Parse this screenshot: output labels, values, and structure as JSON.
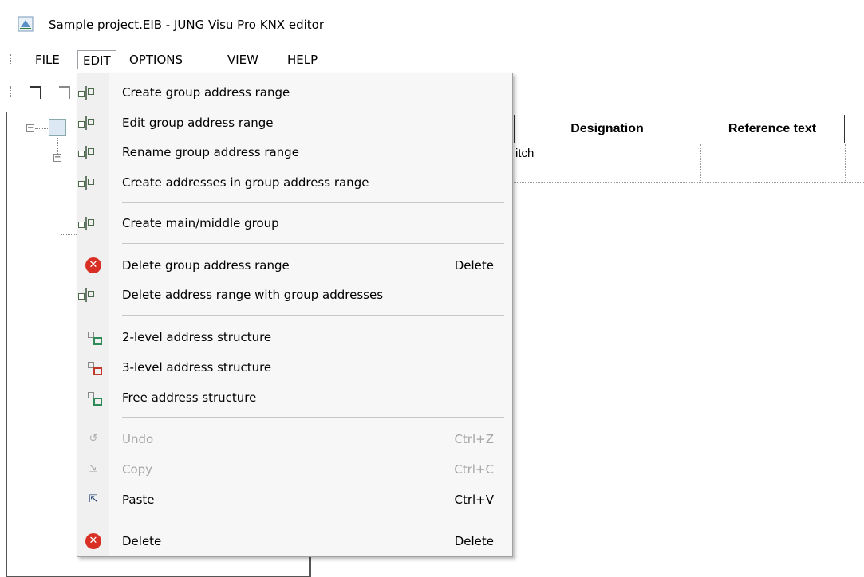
{
  "window": {
    "title": "Sample project.EIB - JUNG Visu Pro KNX editor"
  },
  "menubar": {
    "items": [
      "FILE",
      "EDIT",
      "OPTIONS",
      "VIEW",
      "HELP"
    ],
    "active": "EDIT"
  },
  "table": {
    "columns": [
      "Designation",
      "Reference text"
    ],
    "rows": [
      {
        "designation": "itch",
        "reference": ""
      },
      {
        "designation": "",
        "reference": ""
      }
    ]
  },
  "edit_menu": {
    "items": [
      {
        "label": "Create group address range",
        "shortcut": "",
        "icon": "create-group-address-range-icon",
        "enabled": true
      },
      {
        "label": "Edit group address range",
        "shortcut": "",
        "icon": "edit-group-address-range-icon",
        "enabled": true
      },
      {
        "label": "Rename group address range",
        "shortcut": "",
        "icon": "rename-group-address-range-icon",
        "enabled": true
      },
      {
        "label": "Create addresses in group address range",
        "shortcut": "",
        "icon": "create-addresses-icon",
        "enabled": true
      },
      {
        "label": "Create main/middle group",
        "shortcut": "",
        "icon": "create-main-middle-group-icon",
        "enabled": true
      },
      {
        "label": "Delete group address range",
        "shortcut": "Delete",
        "icon": "delete-red-x-icon",
        "enabled": true
      },
      {
        "label": "Delete address range with group addresses",
        "shortcut": "",
        "icon": "delete-address-range-icon",
        "enabled": true
      },
      {
        "label": "2-level address structure",
        "shortcut": "",
        "icon": "two-level-structure-icon",
        "enabled": true
      },
      {
        "label": "3-level address structure",
        "shortcut": "",
        "icon": "three-level-structure-icon",
        "enabled": true
      },
      {
        "label": "Free address structure",
        "shortcut": "",
        "icon": "free-structure-icon",
        "enabled": true
      },
      {
        "label": "Undo",
        "shortcut": "Ctrl+Z",
        "icon": "undo-icon",
        "enabled": false
      },
      {
        "label": "Copy",
        "shortcut": "Ctrl+C",
        "icon": "copy-icon",
        "enabled": false
      },
      {
        "label": "Paste",
        "shortcut": "Ctrl+V",
        "icon": "paste-icon",
        "enabled": true
      },
      {
        "label": "Delete",
        "shortcut": "Delete",
        "icon": "delete-red-x-icon",
        "enabled": true
      }
    ]
  }
}
